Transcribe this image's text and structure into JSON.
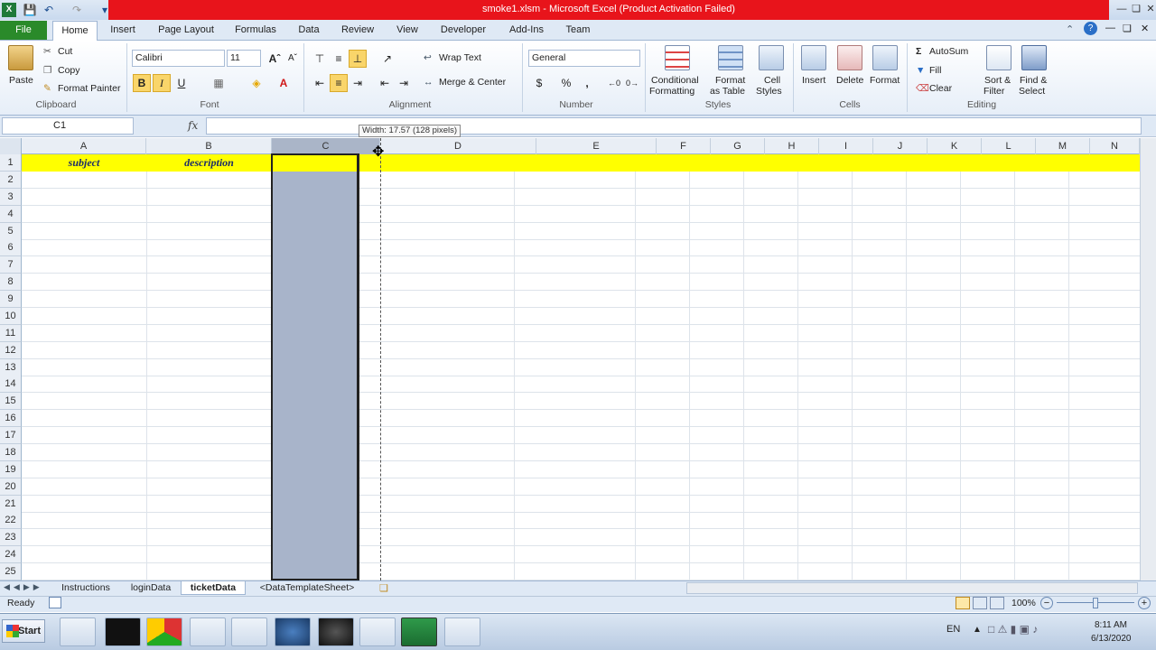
{
  "window": {
    "title": "smoke1.xlsm  -  Microsoft Excel (Product Activation Failed)"
  },
  "ribbon_tabs": [
    "File",
    "Home",
    "Insert",
    "Page Layout",
    "Formulas",
    "Data",
    "Review",
    "View",
    "Developer",
    "Add-Ins",
    "Team"
  ],
  "clipboard": {
    "paste": "Paste",
    "cut": "Cut",
    "copy": "Copy",
    "format_painter": "Format Painter",
    "label": "Clipboard"
  },
  "font": {
    "name": "Calibri",
    "size": "11",
    "label": "Font",
    "bold": "B",
    "italic": "I",
    "underline": "U"
  },
  "alignment": {
    "wrap": "Wrap Text",
    "merge": "Merge & Center",
    "label": "Alignment"
  },
  "number": {
    "format": "General",
    "label": "Number",
    "currency": "$",
    "percent": "%",
    "comma": ","
  },
  "styles": {
    "conditional": "Conditional",
    "conditional2": "Formatting",
    "format_table": "Format",
    "format_table2": "as Table",
    "cell_styles": "Cell",
    "cell_styles2": "Styles",
    "label": "Styles"
  },
  "cells": {
    "insert": "Insert",
    "delete": "Delete",
    "format": "Format",
    "label": "Cells"
  },
  "editing": {
    "autosum": "AutoSum",
    "fill": "Fill",
    "clear": "Clear",
    "sort": "Sort &",
    "sort2": "Filter",
    "find": "Find &",
    "find2": "Select",
    "label": "Editing"
  },
  "formula_bar": {
    "name_box": "C1",
    "fx": "fx",
    "value": "",
    "tooltip": "Width: 17.57 (128 pixels)"
  },
  "columns": [
    "A",
    "B",
    "C",
    "D",
    "E",
    "F",
    "G",
    "H",
    "I",
    "J",
    "K",
    "L",
    "M",
    "N"
  ],
  "rows": [
    "1",
    "2",
    "3",
    "4",
    "5",
    "6",
    "7",
    "8",
    "9",
    "10",
    "11",
    "12",
    "13",
    "14",
    "15",
    "16",
    "17",
    "18",
    "19",
    "20",
    "21",
    "22",
    "23",
    "24",
    "25"
  ],
  "row1": {
    "A": "subject",
    "B": "description"
  },
  "sheets": [
    "Instructions",
    "loginData",
    "ticketData",
    "<DataTemplateSheet>"
  ],
  "status": {
    "ready": "Ready",
    "zoom": "100%"
  },
  "taskbar": {
    "start": "Start",
    "lang": "EN",
    "time": "8:11 AM",
    "date": "6/13/2020"
  },
  "colors": {
    "header_fill": "#ffff00",
    "selection": "#a8b4ca",
    "title_bar": "#e8141b",
    "file_tab": "#2a8a2a"
  }
}
